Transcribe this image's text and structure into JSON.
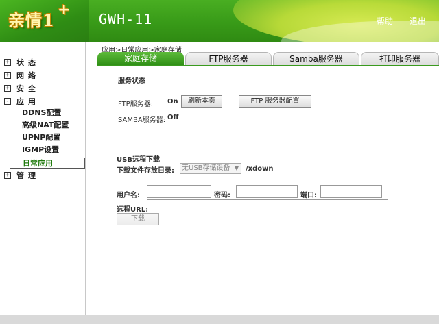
{
  "header": {
    "logo_text": "亲情1",
    "logo_plus": "+",
    "device_name": "GWH-11",
    "help": "帮助",
    "logout": "退出"
  },
  "sidebar": {
    "items": [
      {
        "box": "+",
        "label": "状态"
      },
      {
        "box": "+",
        "label": "网络"
      },
      {
        "box": "+",
        "label": "安全"
      },
      {
        "box": "-",
        "label": "应用"
      },
      {
        "box": "+",
        "label": "管理"
      }
    ],
    "sub_items": [
      "DDNS配置",
      "高级NAT配置",
      "UPNP配置",
      "IGMP设置",
      "日常应用"
    ]
  },
  "breadcrumb": "应用>日常应用>家庭存储",
  "tabs": [
    {
      "label": "家庭存储",
      "active": true
    },
    {
      "label": "FTP服务器",
      "active": false
    },
    {
      "label": "Samba服务器",
      "active": false
    },
    {
      "label": "打印服务器",
      "active": false
    }
  ],
  "service_status": {
    "title": "服务状态",
    "ftp_label": "FTP服务器:",
    "ftp_value": "On",
    "refresh_button": "刷新本页",
    "ftp_config_button": "FTP 服务器配置",
    "samba_label": "SAMBA服务器:",
    "samba_value": "Off"
  },
  "usb_download": {
    "title": "USB远程下载",
    "dir_label": "下载文件存放目录:",
    "dir_select": "无USB存储设备",
    "dir_suffix": "/xdown",
    "username_label": "用户名:",
    "username_value": "",
    "password_label": "密码:",
    "password_value": "",
    "port_label": "端口:",
    "port_value": "",
    "url_label": "远程URL:",
    "url_value": "",
    "download_button": "下载"
  },
  "colors": {
    "brand_green": "#3a9a1e",
    "header_yellow": "#e9f35a"
  }
}
